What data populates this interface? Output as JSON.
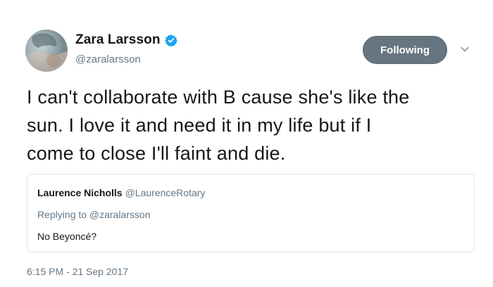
{
  "author": {
    "name": "Zara Larsson",
    "handle": "@zaralarsson",
    "verified": true
  },
  "follow_button": {
    "label": "Following"
  },
  "menu": {
    "icon": "chevron-down-icon"
  },
  "tweet": {
    "lines": [
      "I can't collaborate with B cause she's like the",
      "sun. I love it and need it in my life but if I",
      "come to close I'll faint and die."
    ],
    "timestamp": "6:15 PM - 21 Sep 2017"
  },
  "quoted_tweet": {
    "author_name": "Laurence Nicholls",
    "author_handle": "@LaurenceRotary",
    "replying_to": "Replying to @zaralarsson",
    "text": "No Beyoncé?"
  },
  "colors": {
    "follow_button_bg": "#66757f",
    "verified_badge": "#1da1f2",
    "secondary_text": "#657786"
  }
}
